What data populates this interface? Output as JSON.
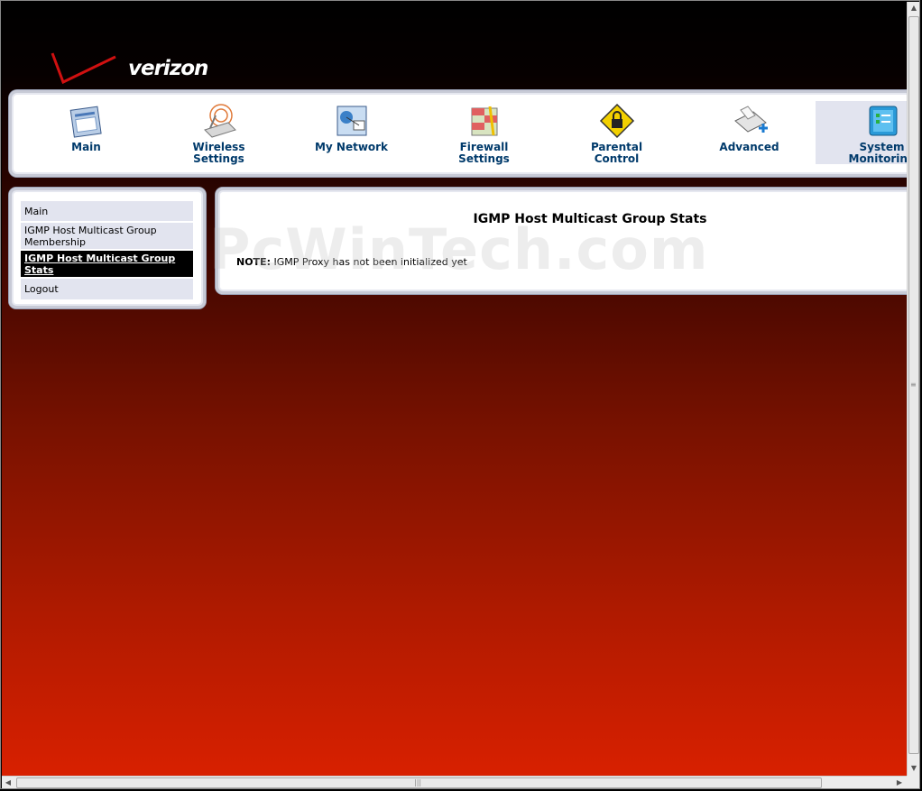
{
  "brand": {
    "logo_text": "verizon"
  },
  "nav": {
    "items": [
      {
        "label_line1": "Main",
        "label_line2": "",
        "icon": "main-icon"
      },
      {
        "label_line1": "Wireless",
        "label_line2": "Settings",
        "icon": "wireless-icon"
      },
      {
        "label_line1": "My Network",
        "label_line2": "",
        "icon": "network-icon"
      },
      {
        "label_line1": "Firewall",
        "label_line2": "Settings",
        "icon": "firewall-icon"
      },
      {
        "label_line1": "Parental",
        "label_line2": "Control",
        "icon": "lock-icon"
      },
      {
        "label_line1": "Advanced",
        "label_line2": "",
        "icon": "advanced-icon"
      },
      {
        "label_line1": "System",
        "label_line2": "Monitoring",
        "icon": "monitor-icon"
      }
    ],
    "active_index": 6
  },
  "sidebar": {
    "items": [
      {
        "label": "Main"
      },
      {
        "label": "IGMP Host Multicast Group Membership"
      },
      {
        "label": "IGMP Host Multicast Group Stats"
      },
      {
        "label": "Logout"
      }
    ],
    "selected_index": 2
  },
  "content": {
    "title": "IGMP Host Multicast Group Stats",
    "note_label": "NOTE:",
    "note_text": " IGMP Proxy has not been initialized yet"
  },
  "watermark": "PcWinTech.com",
  "colors": {
    "nav_text": "#003a6b",
    "active_bg": "#e2e4ef",
    "selected_bg": "#000000"
  }
}
